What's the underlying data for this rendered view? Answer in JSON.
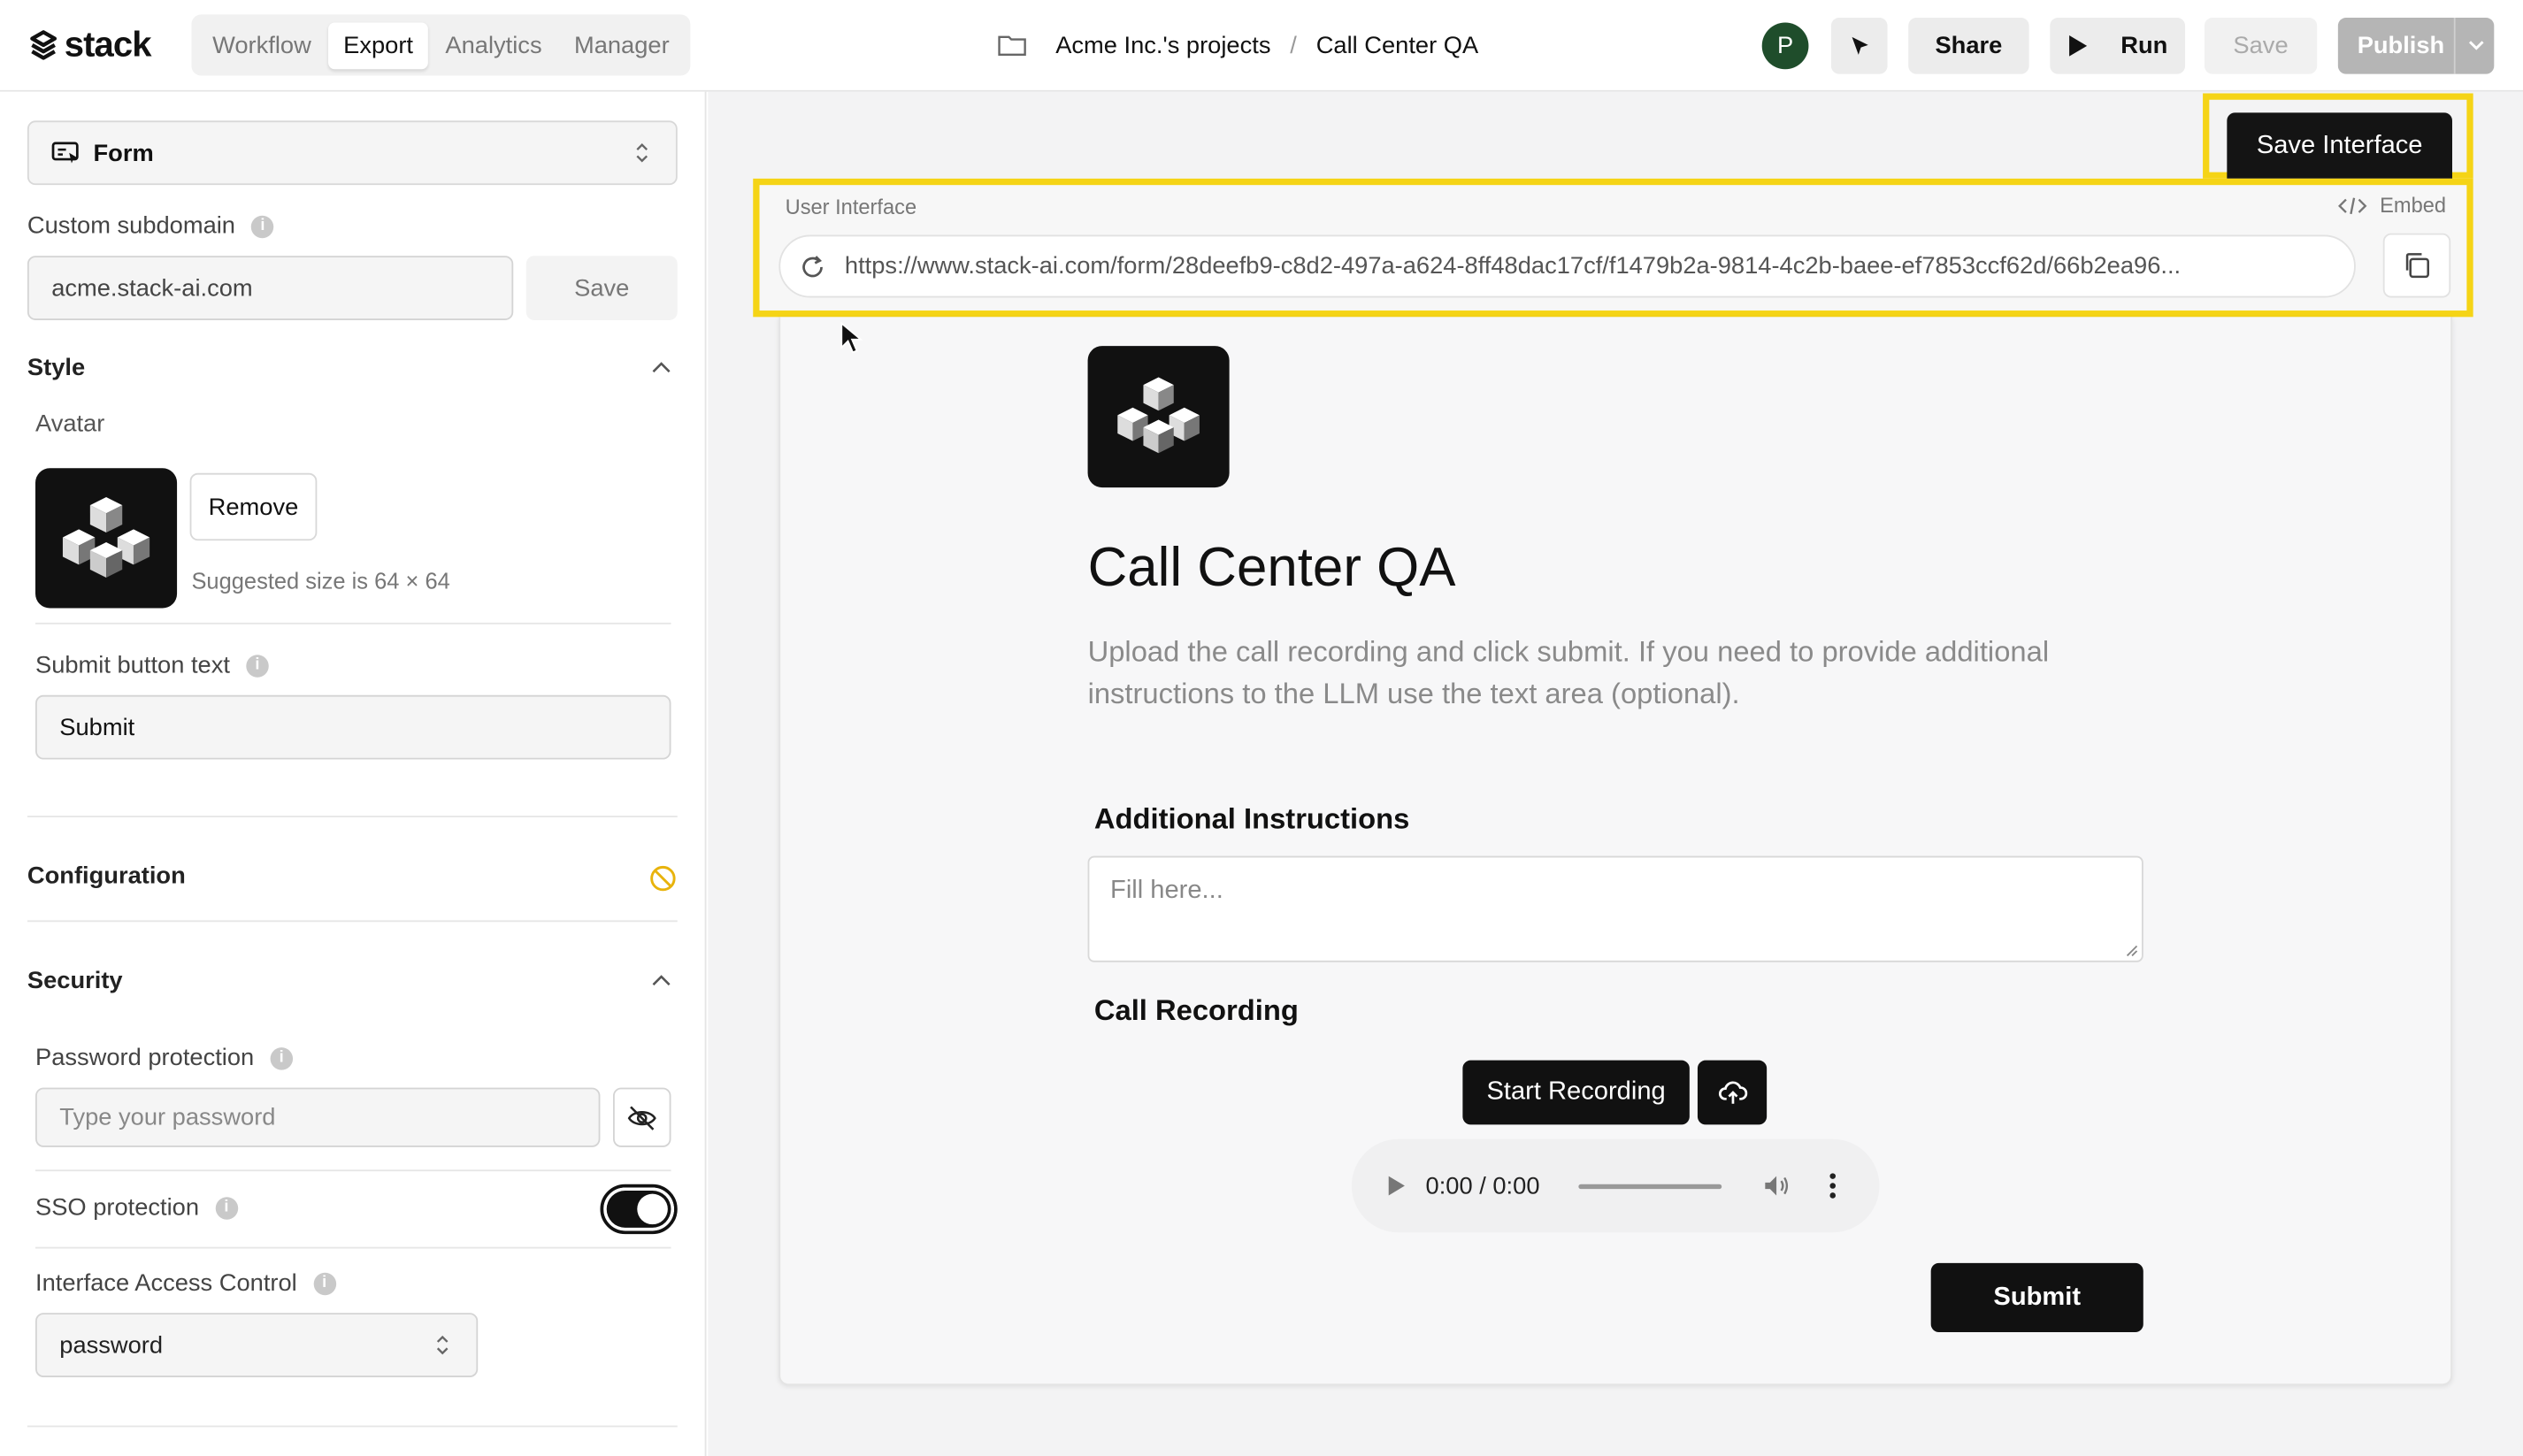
{
  "app": {
    "logo_text": "stack"
  },
  "nav_tabs": [
    {
      "label": "Workflow",
      "active": false
    },
    {
      "label": "Export",
      "active": true
    },
    {
      "label": "Analytics",
      "active": false
    },
    {
      "label": "Manager",
      "active": false
    }
  ],
  "breadcrumb": {
    "project": "Acme Inc.'s projects",
    "separator": "/",
    "current": "Call Center QA"
  },
  "header": {
    "avatar_initial": "P",
    "share_label": "Share",
    "run_label": "Run",
    "save_label": "Save",
    "publish_label": "Publish"
  },
  "left_panel": {
    "interface_type": "Form",
    "custom_subdomain": {
      "label": "Custom subdomain",
      "value": "acme.stack-ai.com",
      "save_label": "Save"
    },
    "style": {
      "title": "Style",
      "avatar_label": "Avatar",
      "remove_label": "Remove",
      "size_hint": "Suggested size is 64 × 64",
      "submit_text_label": "Submit button text",
      "submit_text_value": "Submit"
    },
    "configuration": {
      "title": "Configuration"
    },
    "security": {
      "title": "Security",
      "password_label": "Password protection",
      "password_placeholder": "Type your password",
      "sso_label": "SSO protection",
      "sso_enabled": true,
      "acl_label": "Interface Access Control",
      "acl_value": "password"
    }
  },
  "main": {
    "save_interface_label": "Save Interface",
    "ui_label": "User Interface",
    "embed_label": "Embed",
    "url": "https://www.stack-ai.com/form/28deefb9-c8d2-497a-a624-8ff48dac17cf/f1479b2a-9814-4c2b-baee-ef7853ccf62d/66b2ea96..."
  },
  "preview": {
    "title": "Call Center QA",
    "description": "Upload the call recording and click submit. If you need to provide additional instructions to the LLM use the text area (optional).",
    "instructions_heading": "Additional Instructions",
    "instructions_placeholder": "Fill here...",
    "recording_heading": "Call Recording",
    "start_recording_label": "Start Recording",
    "audio_time": "0:00 / 0:00",
    "submit_label": "Submit"
  },
  "colors": {
    "highlight": "#f5d416",
    "dark": "#111111",
    "avatar_bg": "#1f4d2b"
  }
}
